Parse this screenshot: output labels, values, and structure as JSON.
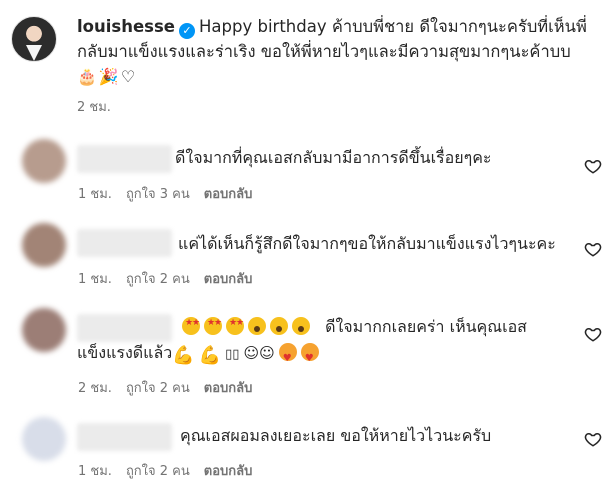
{
  "post": {
    "username": "louishesse",
    "caption_line1": "Happy birthday ค้าบบพี่ชาย ดีใจมากๆนะครับที่เห็นพี่",
    "caption_line2": "กลับมาแข็งแรงและร่าเริง ขอให้พี่หายไวๆและมีความสุขมากๆนะค้าบบ",
    "emojis": "🎂🎉♡",
    "time": "2 ชม."
  },
  "comments": [
    {
      "text": "ดีใจมากที่คุณเอสกลับมามีอาการดีขึ้นเรื่อยๆคะ",
      "time": "1 ชม.",
      "likes": "ถูกใจ 3 คน",
      "reply": "ตอบกลับ"
    },
    {
      "text": "แค่ได้เห็นก็รู้สึกดีใจมากๆขอให้กลับมาแข็งแรงไวๆนะคะ",
      "time": "1 ชม.",
      "likes": "ถูกใจ 2 คน",
      "reply": "ตอบกลับ"
    },
    {
      "text_line1": "ดีใจมากกเลยคร่า เห็นคุณเอส",
      "text_line2": "แข็งแรงดีแล้ว",
      "smiles": "☺☺",
      "boxes": "▯▯",
      "time": "2 ชม.",
      "likes": "ถูกใจ 2 คน",
      "reply": "ตอบกลับ"
    },
    {
      "text": "คุณเอสผอมลงเยอะเลย ขอให้หายไวไวนะครับ",
      "time": "1 ชม.",
      "likes": "ถูกใจ 2 คน",
      "reply": "ตอบกลับ"
    }
  ],
  "colors": {
    "verified": "#0095f6",
    "muted": "#737373",
    "text": "#262626"
  },
  "icons": {
    "verified": "verified-badge-icon",
    "like": "heart-outline-icon"
  }
}
